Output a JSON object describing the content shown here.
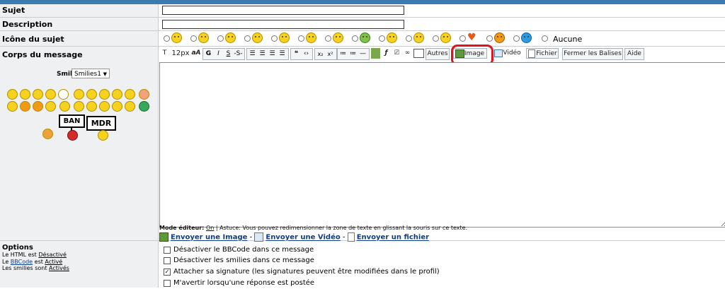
{
  "form": {
    "subject_label": "Sujet",
    "description_label": "Description",
    "icon_label": "Icône du sujet",
    "body_label": "Corps du message",
    "icon_none_label": "Aucune"
  },
  "smilies": {
    "label": "Smilies:",
    "selected": "Smilies1",
    "sign_ban": "BAN",
    "sign_mdr": "MDR"
  },
  "toolbar": {
    "font_size": "12px",
    "font_icon": "aA",
    "bold": "G",
    "italic": "I",
    "underline": "S",
    "strike": "-S-",
    "autres": "Autres",
    "image": "Image",
    "video": "Vidéo",
    "fichier": "Fichier",
    "fermer": "Fermer les Balises",
    "aide": "Aide"
  },
  "editor": {
    "mode_label": "Mode éditeur:",
    "mode_value": "On",
    "tip": " | Astuce: Vous pouvez redimensionner la zone de texte en glissant la souris sur ce texte."
  },
  "links": {
    "send_image": "Envoyer une Image",
    "send_video": "Envoyer une Vidéo",
    "send_file": "Envoyer un fichier",
    "sep": " - "
  },
  "options": {
    "title": "Options",
    "html_prefix": "Le HTML est ",
    "html_status": "Désactivé",
    "bbcode_prefix": "Le ",
    "bbcode_word": "BBCode",
    "bbcode_mid": " est ",
    "bbcode_status": "Activé",
    "smilies_prefix": "Les smilies sont ",
    "smilies_status": "Activés",
    "checks": [
      {
        "label": "Désactiver le BBCode dans ce message",
        "checked": false
      },
      {
        "label": "Désactiver les smilies dans ce message",
        "checked": false
      },
      {
        "label": "Attacher sa signature (les signatures peuvent être modifiées dans le profil)",
        "checked": true
      },
      {
        "label": "M'avertir lorsqu'une réponse est postée",
        "checked": false
      }
    ]
  },
  "colors": {
    "topbar": "#3c7ab0",
    "highlight": "#e0121b",
    "link": "#0b3d8f"
  }
}
